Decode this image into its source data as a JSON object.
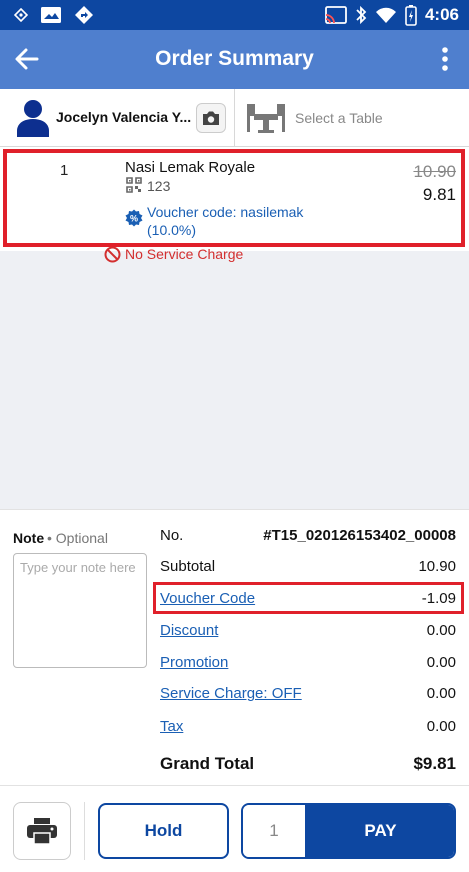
{
  "status_bar": {
    "time": "4:06",
    "icons": [
      "notification-diamond-icon",
      "image-icon",
      "directions-icon",
      "cast-icon",
      "bluetooth-icon",
      "wifi-icon",
      "battery-charging-icon"
    ]
  },
  "app_bar": {
    "title": "Order Summary",
    "back_icon": "arrow-left-icon",
    "menu_icon": "more-vertical-icon"
  },
  "customer": {
    "name": "Jocelyn Valencia Y...",
    "avatar_icon": "person-icon",
    "camera_icon": "camera-icon",
    "table_icon": "table-chairs-icon",
    "table_placeholder": "Select a Table"
  },
  "items": [
    {
      "qty": "1",
      "name": "Nasi Lemak Royale",
      "sku": "123",
      "voucher_line1": "Voucher code: nasilemak",
      "voucher_line2": "(10.0%)",
      "original_price": "10.90",
      "price": "9.81",
      "service_charge_note": "No Service Charge"
    }
  ],
  "note": {
    "label": "Note",
    "optional": "• Optional",
    "placeholder": "Type your note here"
  },
  "summary": {
    "order_no_label": "No.",
    "order_no": "#T15_020126153402_00008",
    "subtotal_label": "Subtotal",
    "subtotal": "10.90",
    "voucher_label": "Voucher Code",
    "voucher": "-1.09",
    "discount_label": "Discount",
    "discount": "0.00",
    "promotion_label": "Promotion",
    "promotion": "0.00",
    "service_label": "Service Charge: OFF",
    "service": "0.00",
    "tax_label": "Tax",
    "tax": "0.00",
    "grand_total_label": "Grand Total",
    "grand_total": "$9.81"
  },
  "actions": {
    "hold_label": "Hold",
    "pay_qty": "1",
    "pay_label": "PAY"
  },
  "colors": {
    "status_bar": "#0d47a1",
    "app_bar": "#4f7fce",
    "primary": "#0d47a1",
    "link": "#1a5fb4",
    "highlight": "#e0202a",
    "warning": "#d32f2f"
  }
}
